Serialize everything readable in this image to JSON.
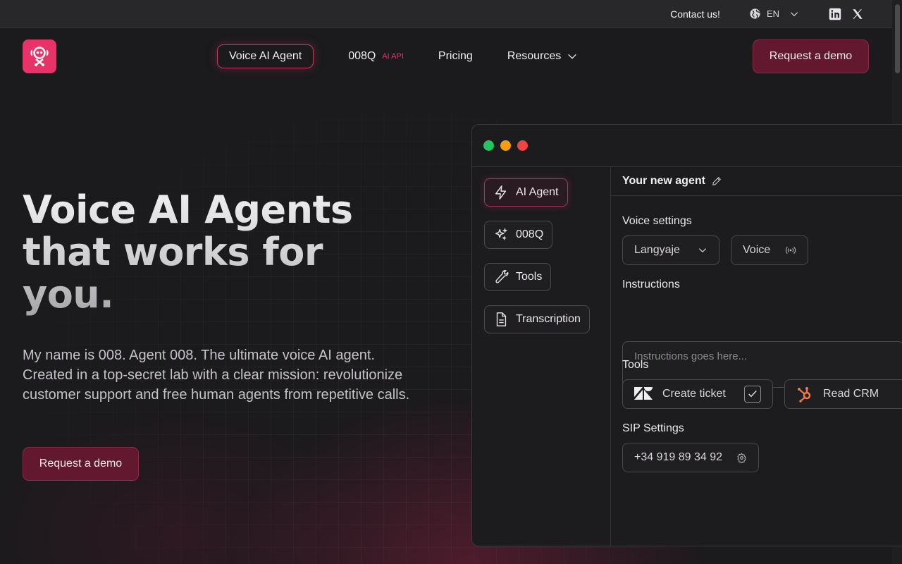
{
  "topbar": {
    "contact": "Contact us!",
    "language": "EN",
    "social": [
      "linkedin-icon",
      "x-icon"
    ]
  },
  "nav": {
    "items": [
      {
        "label": "Voice AI Agent",
        "active": true
      },
      {
        "label": "008Q",
        "tag": "AI API"
      },
      {
        "label": "Pricing"
      },
      {
        "label": "Resources"
      }
    ],
    "cta": "Request a demo"
  },
  "hero": {
    "title_lines": [
      "Voice AI Agents",
      "that works for",
      "you."
    ],
    "description": "My name is 008. Agent 008. The ultimate voice AI agent. Created in a top-secret lab with a clear mission: revolutionize customer support and free human agents from repetitive calls.",
    "cta": "Request a demo"
  },
  "app": {
    "window_dots": [
      "#22c55e",
      "#f59e0b",
      "#ef4444"
    ],
    "sidebar": [
      {
        "label": "AI Agent",
        "icon": "bolt-icon",
        "active": true
      },
      {
        "label": "008Q",
        "icon": "sparkles-icon"
      },
      {
        "label": "Tools",
        "icon": "wrench-icon"
      },
      {
        "label": "Transcription",
        "icon": "document-icon"
      }
    ],
    "agent_name": "Your new agent",
    "voice_settings": {
      "label": "Voice settings",
      "language": "Langyaje",
      "voice": "Voice"
    },
    "instructions": {
      "label": "Instructions",
      "placeholder": "Instructions goes here..."
    },
    "tools": {
      "label": "Tools",
      "items": [
        {
          "label": "Create ticket",
          "icon": "zendesk-icon",
          "checked": true
        },
        {
          "label": "Read CRM",
          "icon": "hubspot-icon"
        }
      ]
    },
    "sip": {
      "label": "SIP Settings",
      "phone": "+34 919 89 34 92"
    }
  },
  "colors": {
    "accent": "#e83368",
    "button_bg": "#62182f",
    "background": "#1b1a1c"
  }
}
